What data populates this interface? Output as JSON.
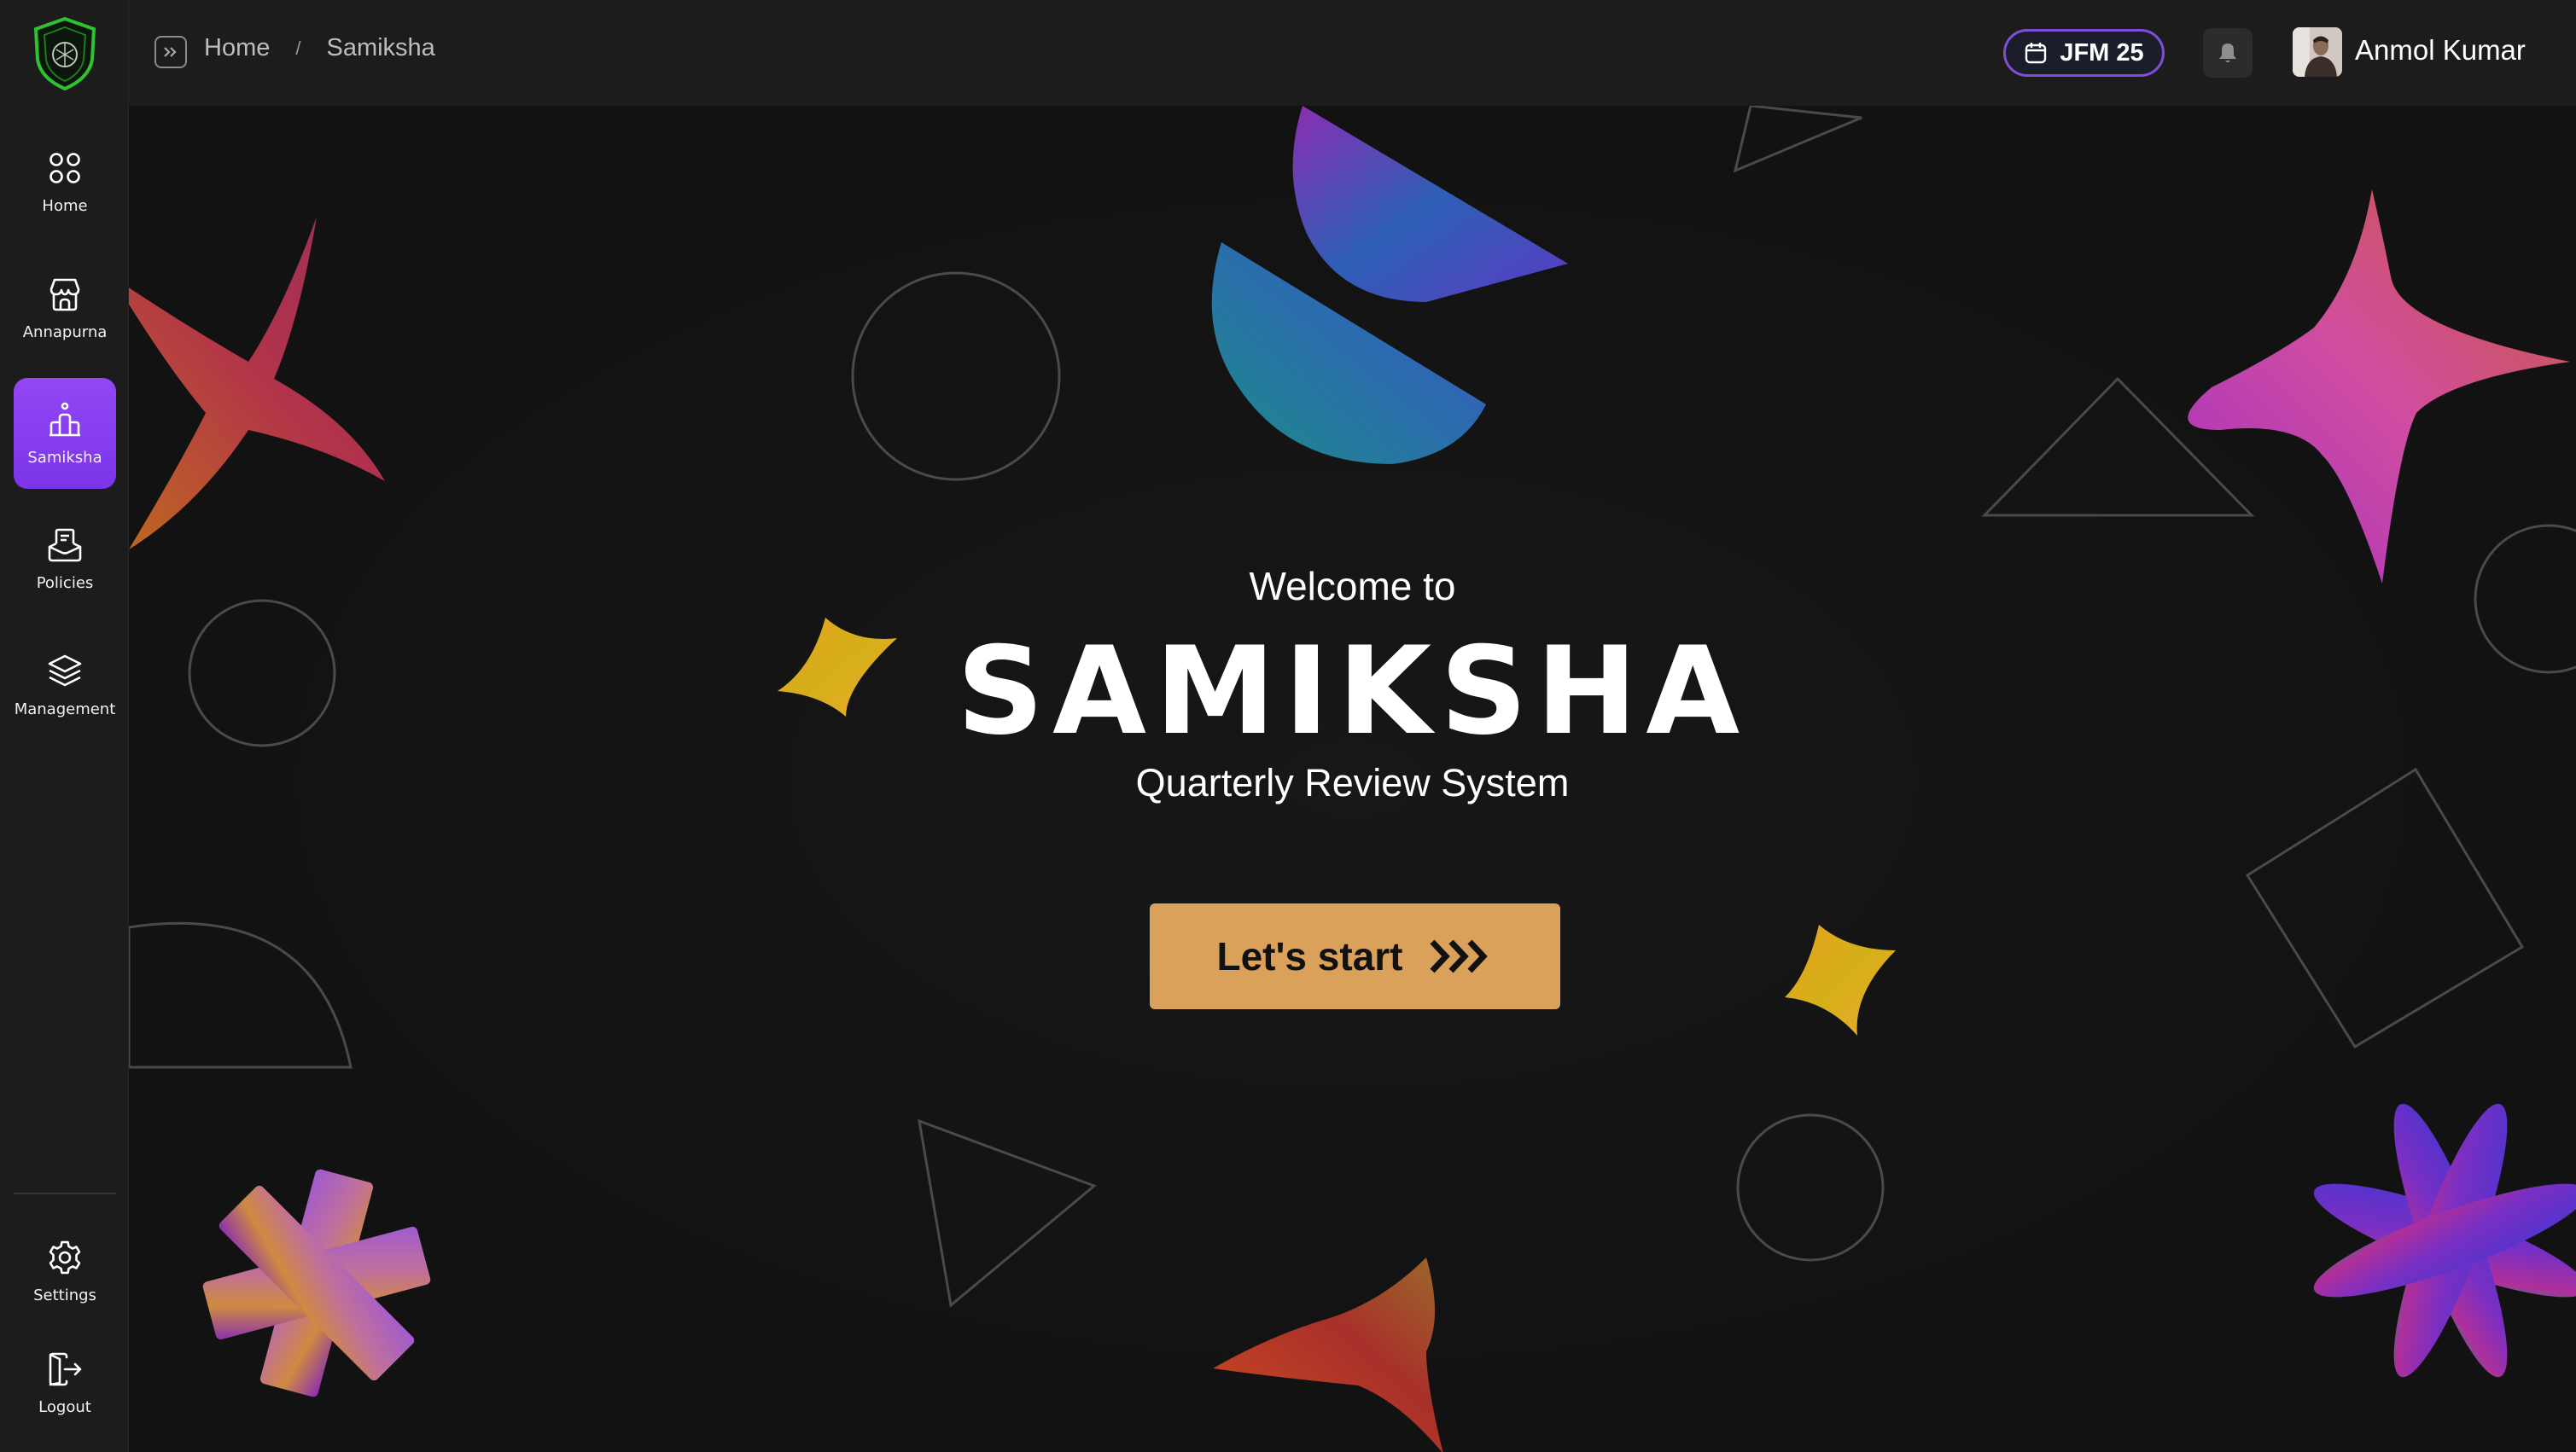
{
  "sidebar": {
    "items": [
      {
        "label": "Home",
        "icon": "grid-icon"
      },
      {
        "label": "Annapurna",
        "icon": "store-icon"
      },
      {
        "label": "Samiksha",
        "icon": "podium-icon",
        "active": true
      },
      {
        "label": "Policies",
        "icon": "inbox-document-icon"
      },
      {
        "label": "Management",
        "icon": "layers-icon"
      }
    ],
    "bottom": [
      {
        "label": "Settings",
        "icon": "gear-icon"
      },
      {
        "label": "Logout",
        "icon": "logout-icon"
      }
    ]
  },
  "header": {
    "breadcrumb": [
      "Home",
      "Samiksha"
    ],
    "breadcrumb_separator": "/",
    "period": "JFM 25",
    "user": {
      "name": "Anmol Kumar"
    }
  },
  "hero": {
    "welcome": "Welcome to",
    "title": "SAMIKSHA",
    "subtitle": "Quarterly Review System",
    "cta_label": "Let's start"
  },
  "colors": {
    "active_nav": "#8a3ffc",
    "cta": "#d9a159",
    "period_border": "#7d4fd6",
    "logo_green": "#2ec22e"
  }
}
